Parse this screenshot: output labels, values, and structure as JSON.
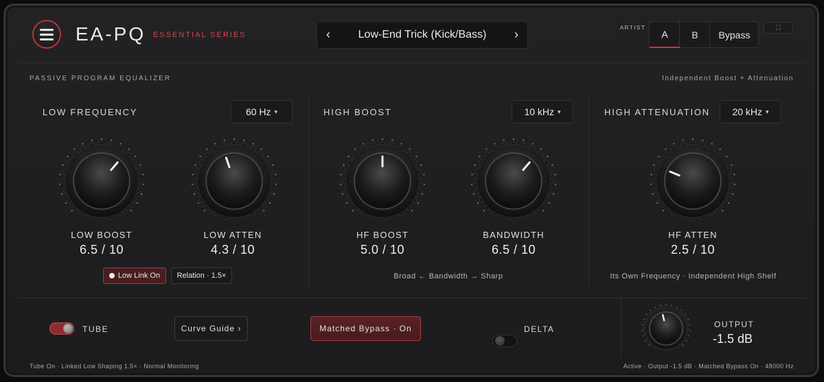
{
  "header": {
    "menu_icon": "hamburger-menu-icon",
    "title": "EA-PQ",
    "series": "ESSENTIAL SERIES",
    "preset": {
      "prev": "‹",
      "name": "Low-End Trick (Kick/Bass)",
      "next": "›"
    },
    "ab": {
      "artist": "ARTIST",
      "a": "A",
      "b": "B",
      "bypass": "Bypass",
      "active": "A"
    },
    "expand_icon": "expand-icon"
  },
  "top_labels": {
    "left": "PASSIVE PROGRAM EQUALIZER",
    "right": "Independent Boost + Attenuation"
  },
  "low_frequency": {
    "title": "LOW FREQUENCY",
    "freq": "60 Hz",
    "caret": "▾",
    "knobs": [
      {
        "label": "LOW BOOST",
        "value": "6.5 / 10",
        "level": 0.65
      },
      {
        "label": "LOW ATTEN",
        "value": "4.3 / 10",
        "level": 0.43
      }
    ],
    "link_label": "Low Link On",
    "relation_label": "Relation · 1.5×"
  },
  "high_boost": {
    "title": "HIGH BOOST",
    "freq": "10 kHz",
    "caret": "▾",
    "knobs": [
      {
        "label": "HF BOOST",
        "value": "5.0 / 10",
        "level": 0.5
      },
      {
        "label": "BANDWIDTH",
        "value": "6.5 / 10",
        "level": 0.65
      }
    ],
    "note": "Broad ← Bandwidth → Sharp"
  },
  "high_atten": {
    "title": "HIGH ATTENUATION",
    "freq": "20 kHz",
    "caret": "▾",
    "knobs": [
      {
        "label": "HF ATTEN",
        "value": "2.5 / 10",
        "level": 0.25
      }
    ],
    "note": "Its Own Frequency · Independent High Shelf"
  },
  "footer": {
    "tube_label": "TUBE",
    "tube_on": true,
    "curve_guide": "Curve Guide ›",
    "matched_bypass": "Matched Bypass · On",
    "delta_label": "DELTA",
    "delta_on": false,
    "output_label": "OUTPUT",
    "output_value": "-1.5 dB",
    "output_level": 0.45,
    "status_left": "Tube On · Linked Low Shaping 1.5× · Normal Monitoring",
    "status_right": "Active · Output -1.5 dB · Matched Bypass On · 48000 Hz"
  },
  "colors": {
    "accent": "#c5363d",
    "background": "#1e1e20"
  }
}
